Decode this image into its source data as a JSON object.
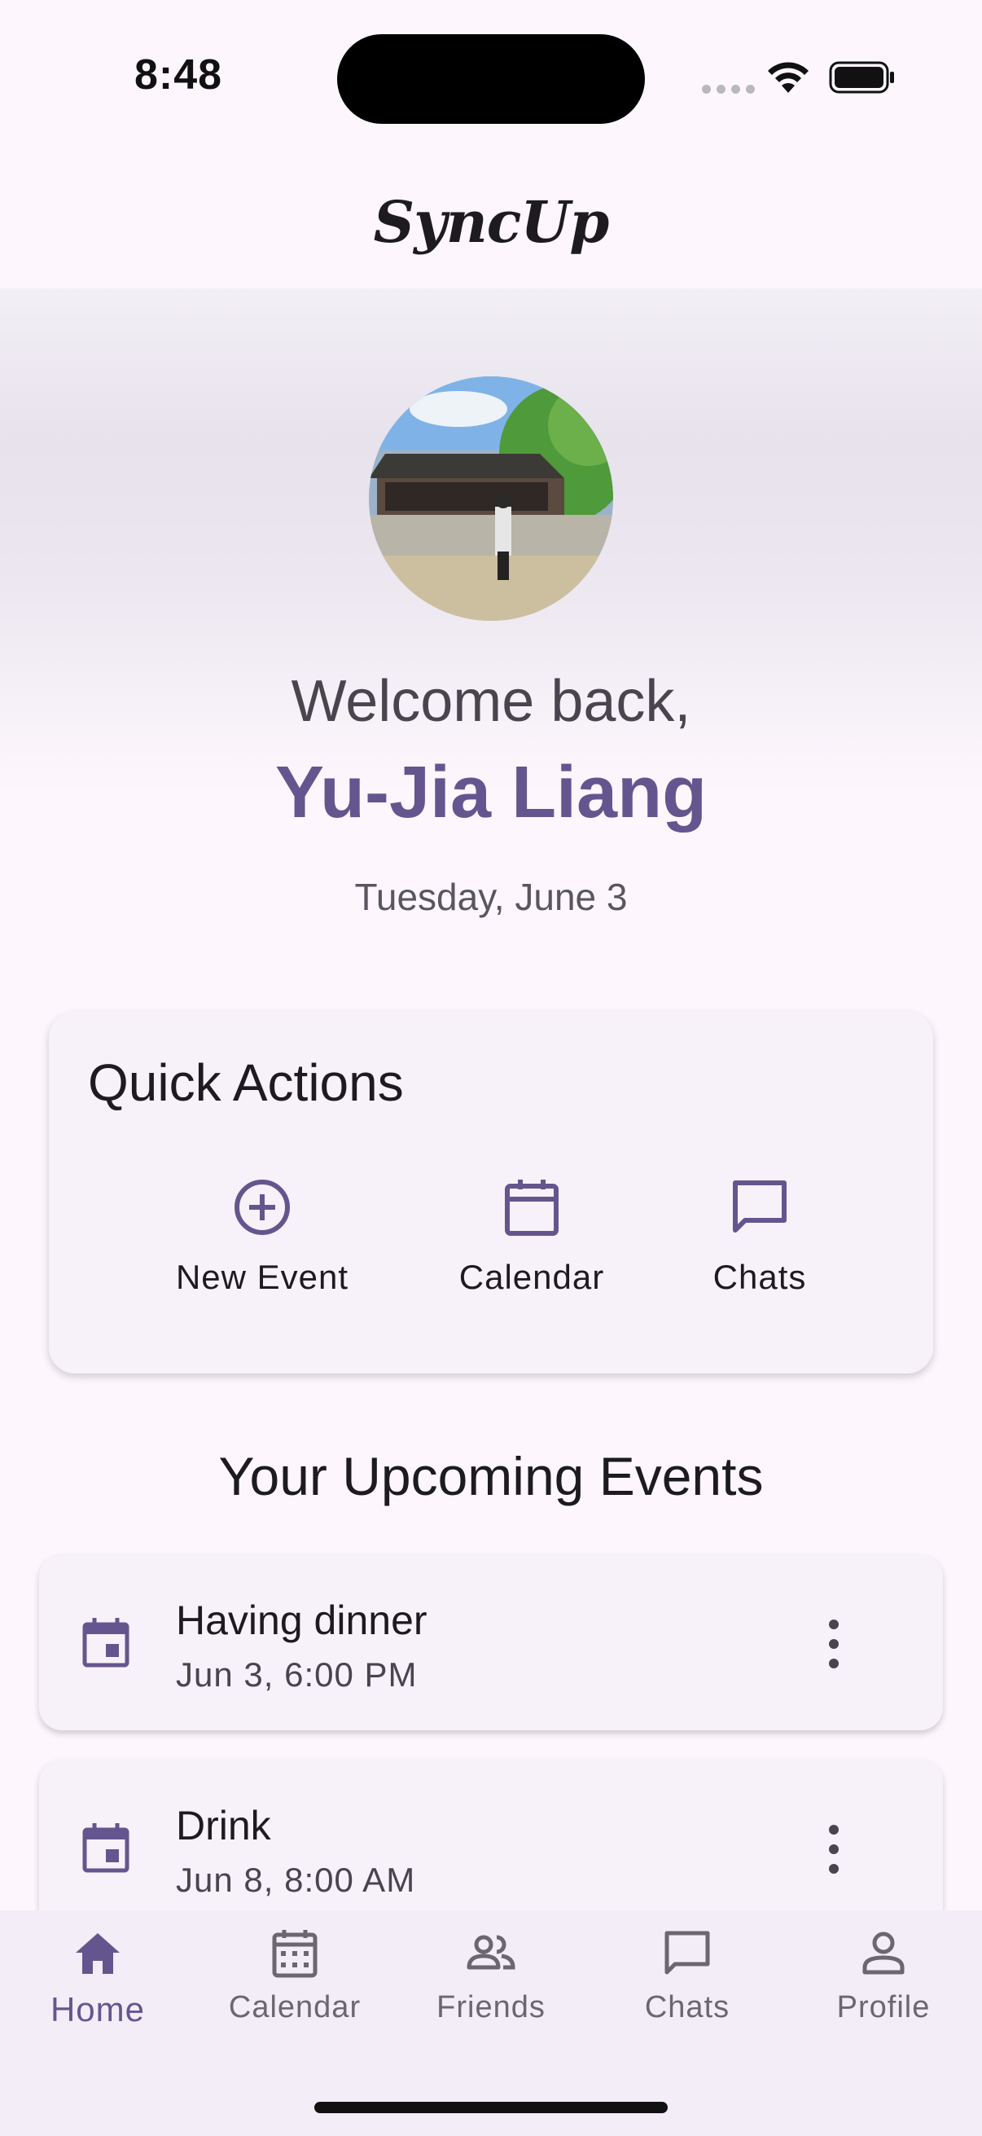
{
  "status_bar": {
    "time": "8:48"
  },
  "app_bar": {
    "title": "SyncUp"
  },
  "hero": {
    "welcome": "Welcome back,",
    "user_name": "Yu-Jia Liang",
    "date": "Tuesday, June 3"
  },
  "quick_actions": {
    "title": "Quick Actions",
    "items": [
      {
        "label": "New Event",
        "icon": "add-circle-icon"
      },
      {
        "label": "Calendar",
        "icon": "calendar-icon"
      },
      {
        "label": "Chats",
        "icon": "chat-icon"
      }
    ]
  },
  "upcoming": {
    "title": "Your Upcoming Events",
    "events": [
      {
        "title": "Having dinner",
        "time": "Jun 3, 6:00 PM"
      },
      {
        "title": "Drink",
        "time": "Jun 8, 8:00 AM"
      }
    ]
  },
  "bottom_nav": {
    "items": [
      {
        "label": "Home",
        "icon": "home-icon",
        "active": true
      },
      {
        "label": "Calendar",
        "icon": "calendar-grid-icon"
      },
      {
        "label": "Friends",
        "icon": "people-icon"
      },
      {
        "label": "Chats",
        "icon": "chat-icon"
      },
      {
        "label": "Profile",
        "icon": "person-icon"
      }
    ]
  },
  "colors": {
    "primary": "#65558f",
    "surface": "#fdf7fd",
    "card": "#f7f2f9"
  }
}
